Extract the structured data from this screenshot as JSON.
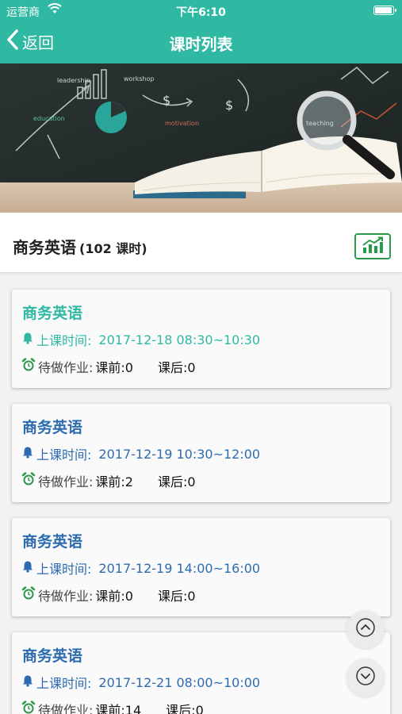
{
  "status_bar": {
    "carrier": "运营商",
    "time": "下午6:10",
    "battery_level": 0.95
  },
  "nav": {
    "back_label": "返回",
    "title": "课时列表"
  },
  "course": {
    "name": "商务英语",
    "hours": "(102 课时)"
  },
  "lessons": [
    {
      "name": "商务英语",
      "time_label": "上课时间:",
      "time": "2017-12-18 08:30~10:30",
      "homework_label": "待做作业:",
      "before": "课前:0",
      "after": "课后:0",
      "state": "active"
    },
    {
      "name": "商务英语",
      "time_label": "上课时间:",
      "time": "2017-12-19 10:30~12:00",
      "homework_label": "待做作业:",
      "before": "课前:2",
      "after": "课后:0",
      "state": "normal"
    },
    {
      "name": "商务英语",
      "time_label": "上课时间:",
      "time": "2017-12-19 14:00~16:00",
      "homework_label": "待做作业:",
      "before": "课前:0",
      "after": "课后:0",
      "state": "normal"
    },
    {
      "name": "商务英语",
      "time_label": "上课时间:",
      "time": "2017-12-21 08:00~10:00",
      "homework_label": "待做作业:",
      "before": "课前:14",
      "after": "课后:0",
      "state": "normal"
    }
  ],
  "banner_text": [
    "leadership",
    "workshop",
    "education",
    "motivation",
    "teaching"
  ],
  "icons": {
    "back": "chevron-left-icon",
    "stats": "chart-growth-icon",
    "bell": "bell-icon",
    "alarm": "alarm-clock-icon",
    "scroll_up": "chevron-up-icon",
    "scroll_down": "chevron-down-icon"
  },
  "colors": {
    "primary": "#2fb9a2",
    "link_blue": "#2d6bb0",
    "green": "#2a9a4a"
  }
}
